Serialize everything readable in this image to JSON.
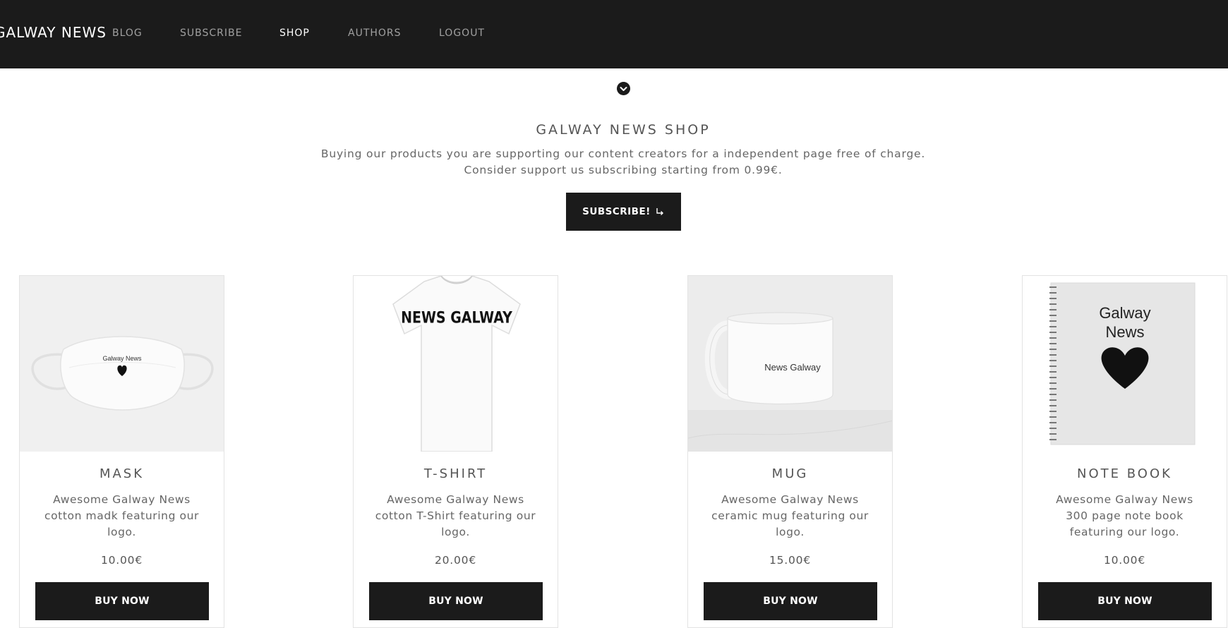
{
  "nav": {
    "brand": "GALWAY NEWS",
    "links": [
      {
        "label": "BLOG",
        "active": false
      },
      {
        "label": "SUBSCRIBE",
        "active": false
      },
      {
        "label": "SHOP",
        "active": true
      },
      {
        "label": "AUTHORS",
        "active": false
      },
      {
        "label": "LOGOUT",
        "active": false
      }
    ]
  },
  "hero": {
    "title": "GALWAY NEWS SHOP",
    "line1": "Buying our products you are supporting our content creators for a independent page free of charge.",
    "line2": "Consider support us subscribing starting from 0.99€.",
    "subscribe_label": "SUBSCRIBE!",
    "subscribe_icon": "return-arrow-icon"
  },
  "products": [
    {
      "name": "MASK",
      "description": "Awesome Galway News cotton madk featuring our logo.",
      "price": "10.00€",
      "button": "BUY NOW",
      "image_text": "Galway News"
    },
    {
      "name": "T-SHIRT",
      "description": "Awesome Galway News cotton T-Shirt featuring our logo.",
      "price": "20.00€",
      "button": "BUY NOW",
      "image_text": "NEWS GALWAY"
    },
    {
      "name": "MUG",
      "description": "Awesome Galway News ceramic mug featuring our logo.",
      "price": "15.00€",
      "button": "BUY NOW",
      "image_text": "News Galway"
    },
    {
      "name": "NOTE BOOK",
      "description": "Awesome Galway News 300 page note book featuring our logo.",
      "price": "10.00€",
      "button": "BUY NOW",
      "image_text": [
        "Galway",
        "News"
      ]
    }
  ],
  "colors": {
    "nav_bg": "#1b1b1b",
    "nav_text": "#a0a0a0",
    "nav_active": "#ffffff",
    "button_bg": "#1b1b1b",
    "text": "#555555"
  }
}
